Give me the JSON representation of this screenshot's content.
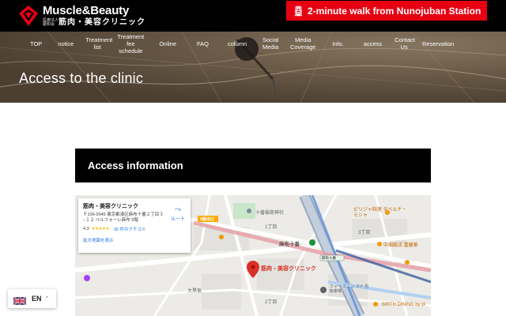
{
  "header": {
    "logo_en": "Muscle&Beauty",
    "logo_corp": "医療法人 慶和会",
    "logo_jp": "筋肉・美容クリニック",
    "walk_text": "2-minute walk from Nunojuban Station",
    "walk_icon": "train-icon"
  },
  "nav": [
    {
      "label": "TOP"
    },
    {
      "label": "notice"
    },
    {
      "label": "Treatment list"
    },
    {
      "label": "Treatment fee schedule"
    },
    {
      "label": "Online"
    },
    {
      "label": "FAQ"
    },
    {
      "label": "column"
    },
    {
      "label": "Social Media"
    },
    {
      "label": "Media Coverage"
    },
    {
      "label": "Info."
    },
    {
      "label": "access"
    },
    {
      "label": "Contact Us"
    },
    {
      "label": "Reservation"
    }
  ],
  "hero": {
    "title": "Access to the clinic"
  },
  "content": {
    "section_title": "Access information"
  },
  "map": {
    "place_name": "筋肉・美容クリニック",
    "address": "〒106-0045 東京都港区麻布十番２丁目３−１２ ベルフォーレ麻布 5階",
    "rating": "4.3",
    "stars": "★★★★★",
    "reviews": "30 件のクチコミ",
    "enlarge_link": "拡大地図を表示",
    "route_label": "ルート",
    "pin_label": "筋肉・美容クリニック",
    "labels": {
      "shrine": "十番稲荷神社",
      "station": "麻布十番",
      "exit": "麻布十番",
      "exit4": "4番出口",
      "street1": "1丁目",
      "street2": "2丁目",
      "street3": "3丁目",
      "restaurant1": "ピリジャ料理 タベルナ・ミシャ",
      "restaurant2": "中国飯店 富麗華",
      "restaurant3": "BIRTH DINING by pl",
      "ward": "大黒坂",
      "hotel": "ミャー ミニン スナ 自転車等"
    },
    "colors": {
      "pin": "#d93025",
      "metro_red": "#e8a0a8",
      "metro_blue": "#5b8fd9",
      "road": "#ffffff"
    }
  },
  "language": {
    "code": "EN",
    "flag": "uk-flag-icon"
  }
}
